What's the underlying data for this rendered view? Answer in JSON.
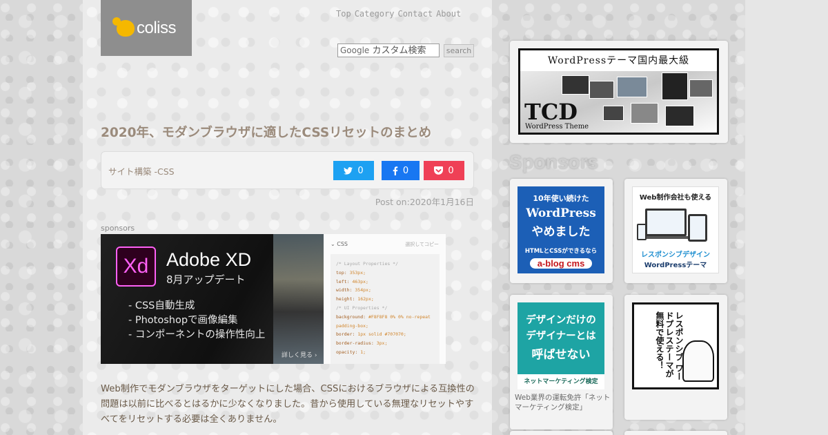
{
  "site": {
    "logo_text": "coliss",
    "nav": [
      "Top",
      "Category",
      "Contact",
      "About"
    ],
    "search": {
      "placeholder_brand": "Google",
      "placeholder": "カスタム検索",
      "button": "search"
    }
  },
  "article": {
    "title": "2020年、モダンブラウザに適したCSSリセットのまとめ",
    "category": "サイト構築 -CSS",
    "share": {
      "twitter": "0",
      "facebook": "0",
      "pocket": "0"
    },
    "date": "Post on:2020年1月16日",
    "sponsors_label": "sponsors",
    "body": "Web制作でモダンブラウザをターゲットにした場合、CSSにおけるブラウザによる互換性の問題は以前に比べるとはるかに少なくなりました。昔から使用している無理なリセットやすべてをリセットする必要は全くありません。"
  },
  "ad_banner": {
    "logo": "Xd",
    "title": "Adobe XD",
    "subtitle": "8月アップデート",
    "features": [
      "- CSS自動生成",
      "- Photoshopで画像編集",
      "- コンポーネントの操作性向上"
    ],
    "more": "詳しく見る ›",
    "panel_title": "CSS",
    "panel_copy": "選択してコピー",
    "css_lines": [
      {
        "type": "c",
        "text": "/* Layout Properties */"
      },
      {
        "type": "kv",
        "k": "top:",
        "v": " 353px;"
      },
      {
        "type": "kv",
        "k": "left:",
        "v": " 463px;"
      },
      {
        "type": "kv",
        "k": "width:",
        "v": " 354px;"
      },
      {
        "type": "kv",
        "k": "height:",
        "v": " 162px;"
      },
      {
        "type": "c",
        "text": "/* UI Properties */"
      },
      {
        "type": "kv",
        "k": "background:",
        "v": " #F8F8F8 0% 0% no-repeat padding-box;"
      },
      {
        "type": "kv",
        "k": "border:",
        "v": " 1px solid #707070;"
      },
      {
        "type": "kv",
        "k": "border-radius:",
        "v": " 3px;"
      },
      {
        "type": "kv",
        "k": "opacity:",
        "v": " 1;"
      }
    ]
  },
  "sidebar": {
    "tcd": {
      "top": "WordPressテーマ国内最大級",
      "logo": "TCD",
      "sub": "WordPress Theme"
    },
    "title": "Sponsors",
    "ad_wp": {
      "l1": "10年使い続けた",
      "l2": "WordPress",
      "l3": "やめました",
      "l4": "HTMLとCSSができるなら",
      "l5": "a-blog cms"
    },
    "ad_resp": {
      "l1": "Web制作会社も使える",
      "l2": "レスポンシブデザイン",
      "l3": "WordPressテーマ"
    },
    "ad_des": {
      "l1": "デザインだけの",
      "l2": "デザイナーとは",
      "l3": "呼ばせない",
      "l4": "ネットマーケティング検定"
    },
    "ad_des_caption": "Web業界の運転免許「ネットマーケティング検定」",
    "ad_manga": {
      "text": "レスポンシブ ワードプレステーマが 無料で使える！"
    }
  },
  "colors": {
    "twitter": "#1da1f2",
    "facebook": "#1877f2",
    "pocket": "#ef4056",
    "title": "#9b8b7c",
    "logo_accent": "#f5b800"
  }
}
